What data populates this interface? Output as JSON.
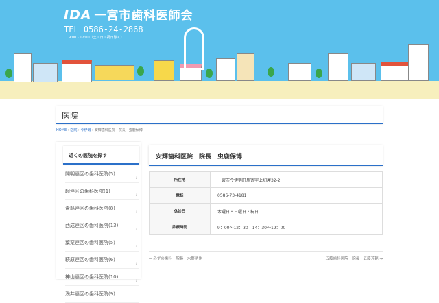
{
  "header": {
    "logo_mark": "IDA",
    "site_name": "一宮市歯科医師会",
    "tel": "TEL 0586-24-2868",
    "hours": "9:00 - 17:00（土・日・祝日除く）"
  },
  "page_title": "医院",
  "breadcrumb": [
    {
      "label": "HOME"
    },
    {
      "label": "医院"
    },
    {
      "label": "今伊勢"
    },
    {
      "label": "安輝歯科医院　院長　虫鹿保博"
    }
  ],
  "breadcrumb_sep": "›",
  "sidebar": {
    "heading": "近くの医院を探す",
    "items": [
      {
        "label": "開明連区の歯科医院(5)"
      },
      {
        "label": "起連区の歯科医院(1)"
      },
      {
        "label": "貴船連区の歯科医院(8)"
      },
      {
        "label": "西成連区の歯科医院(13)"
      },
      {
        "label": "葉栗連区の歯科医院(5)"
      },
      {
        "label": "萩原連区の歯科医院(6)"
      },
      {
        "label": "神山連区の歯科医院(10)"
      },
      {
        "label": "浅井連区の歯科医院(9)"
      }
    ]
  },
  "article": {
    "title": "安輝歯科医院　院長　虫鹿保博",
    "rows": [
      {
        "label": "所在地",
        "value": "一宮市今伊勢町馬寄字上切屋32-2"
      },
      {
        "label": "電話",
        "value": "0586-73-4181"
      },
      {
        "label": "休診日",
        "value": "木曜日・日曜日・祝日"
      },
      {
        "label": "診療時間",
        "value": "9：00〜12：30　14：30〜19：00"
      }
    ]
  },
  "prev_link": "← みずの歯科　院長　水野浩伸",
  "next_link": "五藤歯科医院　院長　五藤芳範 →"
}
